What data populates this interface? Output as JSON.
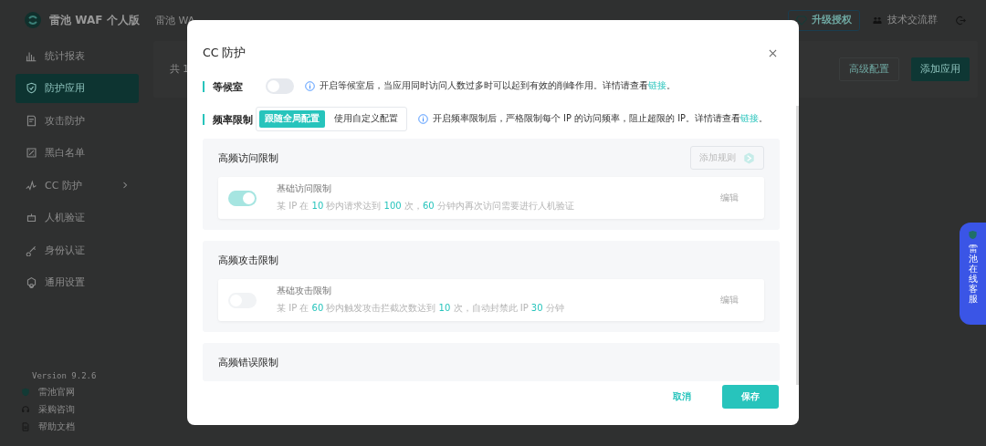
{
  "sidebar": {
    "brand": "雷池 WAF 个人版",
    "items": [
      {
        "label": "统计报表",
        "selected": false,
        "expandable": false
      },
      {
        "label": "防护应用",
        "selected": true,
        "expandable": false
      },
      {
        "label": "攻击防护",
        "selected": false,
        "expandable": false
      },
      {
        "label": "黑白名单",
        "selected": false,
        "expandable": false
      },
      {
        "label": "CC 防护",
        "selected": false,
        "expandable": true
      },
      {
        "label": "人机验证",
        "selected": false,
        "expandable": false
      },
      {
        "label": "身份认证",
        "selected": false,
        "expandable": false
      },
      {
        "label": "通用设置",
        "selected": false,
        "expandable": false
      }
    ],
    "version": "Version 9.2.6",
    "links": [
      {
        "label": "雷池官网"
      },
      {
        "label": "采购咨询"
      },
      {
        "label": "帮助文档"
      }
    ]
  },
  "header": {
    "breadcrumb": "雷池 WA",
    "upgrade": "升级授权",
    "community": "技术交流群"
  },
  "content": {
    "count": "共 1",
    "buttons": [
      "高级配置",
      "添加应用"
    ]
  },
  "dialog": {
    "title": "CC 防护",
    "waiting_room": {
      "label": "等候室",
      "on": false,
      "info": "开启等候室后，当应用同时访问人数过多时可以起到有效的削峰作用。详情请查看",
      "link": "链接",
      "end": "。"
    },
    "rate_limit": {
      "label": "频率限制",
      "options": [
        {
          "label": "跟随全局配置",
          "selected": true
        },
        {
          "label": "使用自定义配置",
          "selected": false
        }
      ],
      "info": "开启频率限制后，严格限制每个 IP 的访问频率，阻止超限的 IP。详情请查看",
      "link": "链接",
      "end": "。"
    },
    "groups": [
      {
        "title": "高频访问限制",
        "add_button": "添加规则",
        "rules": [
          {
            "name": "基础访问限制",
            "on": true,
            "action": "编辑",
            "parts": [
              {
                "text": "某 IP 在 ",
                "highlight": false
              },
              {
                "text": "10",
                "highlight": true
              },
              {
                "text": " 秒内请求达到 ",
                "highlight": false
              },
              {
                "text": "100",
                "highlight": true
              },
              {
                "text": " 次，",
                "highlight": false
              },
              {
                "text": "60",
                "highlight": true
              },
              {
                "text": " 分钟内再次访问需要进行人机验证",
                "highlight": false
              }
            ]
          }
        ]
      },
      {
        "title": "高频攻击限制",
        "rules": [
          {
            "name": "基础攻击限制",
            "on": false,
            "action": "编辑",
            "parts": [
              {
                "text": "某 IP 在 ",
                "highlight": false
              },
              {
                "text": "60",
                "highlight": true
              },
              {
                "text": " 秒内触发攻击拦截次数达到 ",
                "highlight": false
              },
              {
                "text": "10",
                "highlight": true
              },
              {
                "text": " 次，自动封禁此 IP ",
                "highlight": false
              },
              {
                "text": "30",
                "highlight": true
              },
              {
                "text": " 分钟",
                "highlight": false
              }
            ]
          }
        ]
      },
      {
        "title": "高频错误限制"
      }
    ],
    "cancel": "取消",
    "save": "保存"
  },
  "support_tab": {
    "label": "雷池在线客服"
  }
}
